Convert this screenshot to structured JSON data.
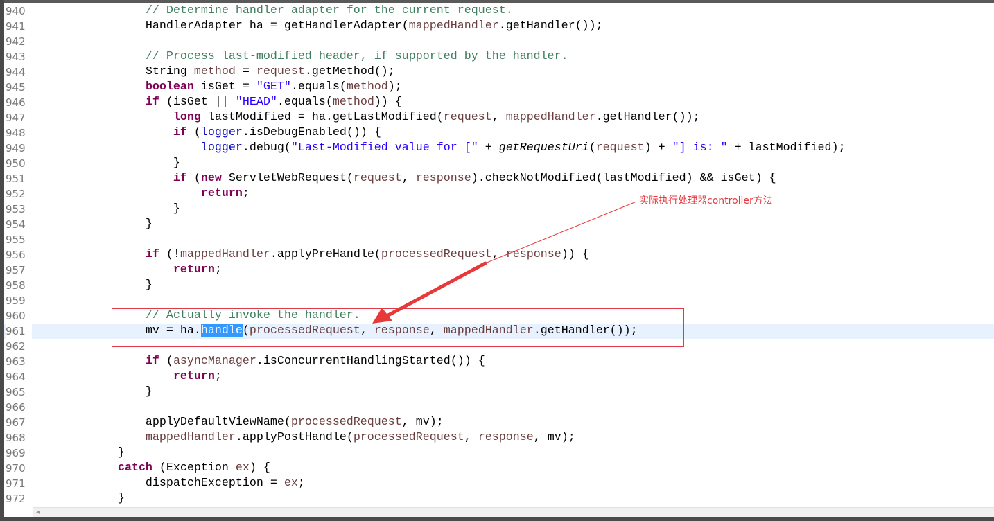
{
  "editor": {
    "current_line": "961",
    "lines": [
      {
        "n": "940",
        "t": [
          [
            "p",
            "                "
          ],
          [
            "c",
            "// Determine handler adapter for the current request."
          ]
        ]
      },
      {
        "n": "941",
        "t": [
          [
            "p",
            "                HandlerAdapter ha = getHandlerAdapter("
          ],
          [
            "v",
            "mappedHandler"
          ],
          [
            "p",
            ".getHandler());"
          ]
        ]
      },
      {
        "n": "942",
        "t": []
      },
      {
        "n": "943",
        "t": [
          [
            "p",
            "                "
          ],
          [
            "c",
            "// Process last-modified header, if supported by the handler."
          ]
        ]
      },
      {
        "n": "944",
        "t": [
          [
            "p",
            "                String "
          ],
          [
            "v",
            "method"
          ],
          [
            "p",
            " = "
          ],
          [
            "v",
            "request"
          ],
          [
            "p",
            ".getMethod();"
          ]
        ]
      },
      {
        "n": "945",
        "t": [
          [
            "p",
            "                "
          ],
          [
            "k",
            "boolean"
          ],
          [
            "p",
            " isGet = "
          ],
          [
            "s",
            "\"GET\""
          ],
          [
            "p",
            ".equals("
          ],
          [
            "v",
            "method"
          ],
          [
            "p",
            ");"
          ]
        ]
      },
      {
        "n": "946",
        "t": [
          [
            "p",
            "                "
          ],
          [
            "k",
            "if"
          ],
          [
            "p",
            " (isGet || "
          ],
          [
            "s",
            "\"HEAD\""
          ],
          [
            "p",
            ".equals("
          ],
          [
            "v",
            "method"
          ],
          [
            "p",
            ")) {"
          ]
        ]
      },
      {
        "n": "947",
        "t": [
          [
            "p",
            "                    "
          ],
          [
            "k",
            "long"
          ],
          [
            "p",
            " lastModified = ha.getLastModified("
          ],
          [
            "v",
            "request"
          ],
          [
            "p",
            ", "
          ],
          [
            "v",
            "mappedHandler"
          ],
          [
            "p",
            ".getHandler());"
          ]
        ]
      },
      {
        "n": "948",
        "t": [
          [
            "p",
            "                    "
          ],
          [
            "k",
            "if"
          ],
          [
            "p",
            " ("
          ],
          [
            "f",
            "logger"
          ],
          [
            "p",
            ".isDebugEnabled()) {"
          ]
        ]
      },
      {
        "n": "949",
        "t": [
          [
            "p",
            "                        "
          ],
          [
            "f",
            "logger"
          ],
          [
            "p",
            ".debug("
          ],
          [
            "s",
            "\"Last-Modified value for [\""
          ],
          [
            "p",
            " + "
          ],
          [
            "m",
            "getRequestUri"
          ],
          [
            "p",
            "("
          ],
          [
            "v",
            "request"
          ],
          [
            "p",
            ") + "
          ],
          [
            "s",
            "\"] is: \""
          ],
          [
            "p",
            " + lastModified);"
          ]
        ]
      },
      {
        "n": "950",
        "t": [
          [
            "p",
            "                    }"
          ]
        ]
      },
      {
        "n": "951",
        "t": [
          [
            "p",
            "                    "
          ],
          [
            "k",
            "if"
          ],
          [
            "p",
            " ("
          ],
          [
            "k",
            "new"
          ],
          [
            "p",
            " ServletWebRequest("
          ],
          [
            "v",
            "request"
          ],
          [
            "p",
            ", "
          ],
          [
            "v",
            "response"
          ],
          [
            "p",
            ").checkNotModified(lastModified) && isGet) {"
          ]
        ]
      },
      {
        "n": "952",
        "t": [
          [
            "p",
            "                        "
          ],
          [
            "k",
            "return"
          ],
          [
            "p",
            ";"
          ]
        ]
      },
      {
        "n": "953",
        "t": [
          [
            "p",
            "                    }"
          ]
        ]
      },
      {
        "n": "954",
        "t": [
          [
            "p",
            "                }"
          ]
        ]
      },
      {
        "n": "955",
        "t": []
      },
      {
        "n": "956",
        "t": [
          [
            "p",
            "                "
          ],
          [
            "k",
            "if"
          ],
          [
            "p",
            " (!"
          ],
          [
            "v",
            "mappedHandler"
          ],
          [
            "p",
            ".applyPreHandle("
          ],
          [
            "v",
            "processedRequest"
          ],
          [
            "p",
            ", "
          ],
          [
            "v",
            "response"
          ],
          [
            "p",
            ")) {"
          ]
        ]
      },
      {
        "n": "957",
        "t": [
          [
            "p",
            "                    "
          ],
          [
            "k",
            "return"
          ],
          [
            "p",
            ";"
          ]
        ]
      },
      {
        "n": "958",
        "t": [
          [
            "p",
            "                }"
          ]
        ]
      },
      {
        "n": "959",
        "t": []
      },
      {
        "n": "960",
        "t": [
          [
            "p",
            "                "
          ],
          [
            "c",
            "// Actually invoke the handler."
          ]
        ]
      },
      {
        "n": "961",
        "t": [
          [
            "p",
            "                mv = ha."
          ],
          [
            "sel",
            "handle"
          ],
          [
            "p",
            "("
          ],
          [
            "v",
            "processedRequest"
          ],
          [
            "p",
            ", "
          ],
          [
            "v",
            "response"
          ],
          [
            "p",
            ", "
          ],
          [
            "v",
            "mappedHandler"
          ],
          [
            "p",
            ".getHandler());"
          ]
        ]
      },
      {
        "n": "962",
        "t": []
      },
      {
        "n": "963",
        "t": [
          [
            "p",
            "                "
          ],
          [
            "k",
            "if"
          ],
          [
            "p",
            " ("
          ],
          [
            "v",
            "asyncManager"
          ],
          [
            "p",
            ".isConcurrentHandlingStarted()) {"
          ]
        ]
      },
      {
        "n": "964",
        "t": [
          [
            "p",
            "                    "
          ],
          [
            "k",
            "return"
          ],
          [
            "p",
            ";"
          ]
        ]
      },
      {
        "n": "965",
        "t": [
          [
            "p",
            "                }"
          ]
        ]
      },
      {
        "n": "966",
        "t": []
      },
      {
        "n": "967",
        "t": [
          [
            "p",
            "                applyDefaultViewName("
          ],
          [
            "v",
            "processedRequest"
          ],
          [
            "p",
            ", mv);"
          ]
        ]
      },
      {
        "n": "968",
        "t": [
          [
            "p",
            "                "
          ],
          [
            "v",
            "mappedHandler"
          ],
          [
            "p",
            ".applyPostHandle("
          ],
          [
            "v",
            "processedRequest"
          ],
          [
            "p",
            ", "
          ],
          [
            "v",
            "response"
          ],
          [
            "p",
            ", mv);"
          ]
        ]
      },
      {
        "n": "969",
        "t": [
          [
            "p",
            "            }"
          ]
        ]
      },
      {
        "n": "970",
        "t": [
          [
            "p",
            "            "
          ],
          [
            "k",
            "catch"
          ],
          [
            "p",
            " (Exception "
          ],
          [
            "v",
            "ex"
          ],
          [
            "p",
            ") {"
          ]
        ]
      },
      {
        "n": "971",
        "t": [
          [
            "p",
            "                dispatchException = "
          ],
          [
            "v",
            "ex"
          ],
          [
            "p",
            ";"
          ]
        ]
      },
      {
        "n": "972",
        "t": [
          [
            "p",
            "            }"
          ]
        ]
      }
    ]
  },
  "annotation": {
    "text": "实际执行处理器controller方法",
    "color": "#e53940"
  },
  "scrollbar": {
    "left_arrow_icon": "◂"
  },
  "colors": {
    "keyword": "#7F0055",
    "comment": "#3F7F5F",
    "string": "#2A00FF",
    "field": "#0000C0",
    "local_variable": "#6A3E3E",
    "selection": "#3399ff",
    "current_line": "#e8f2fe"
  }
}
